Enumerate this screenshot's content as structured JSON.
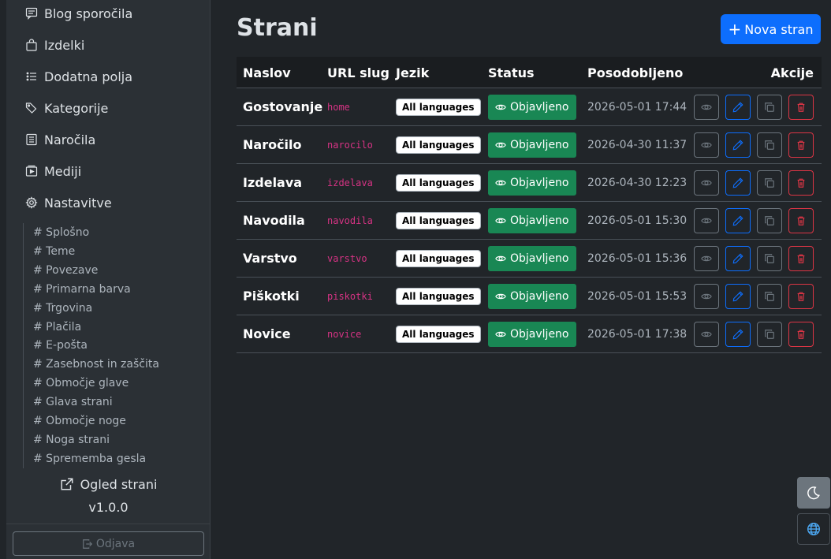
{
  "sidebar": {
    "items": [
      {
        "label": "Blog sporočila",
        "icon": "chat-square-icon"
      },
      {
        "label": "Izdelki",
        "icon": "bag-icon"
      },
      {
        "label": "Dodatna polja",
        "icon": "list-icon"
      },
      {
        "label": "Kategorije",
        "icon": "tags-icon"
      },
      {
        "label": "Naročila",
        "icon": "receipt-icon"
      },
      {
        "label": "Mediji",
        "icon": "media-icon"
      },
      {
        "label": "Nastavitve",
        "icon": "gear-icon"
      }
    ],
    "settings_items": [
      "# Splošno",
      "# Teme",
      "# Povezave",
      "# Primarna barva",
      "# Trgovina",
      "# Plačila",
      "# E-pošta",
      "# Zasebnost in zaščita",
      "# Območje glave",
      "# Glava strani",
      "# Območje noge",
      "# Noga strani",
      "# Sprememba gesla"
    ],
    "preview_label": "Ogled strani",
    "version": "v1.0.0",
    "logout_label": "Odjava"
  },
  "main": {
    "title": "Strani",
    "new_button_label": "Nova stran",
    "table": {
      "headers": {
        "title": "Naslov",
        "slug": "URL slug",
        "language": "Jezik",
        "status": "Status",
        "updated": "Posodobljeno",
        "actions": "Akcije"
      },
      "rows": [
        {
          "title": "Gostovanje",
          "slug": "home",
          "language": "All languages",
          "status": "Objavljeno",
          "updated": "2026-05-01 17:44"
        },
        {
          "title": "Naročilo",
          "slug": "narocilo",
          "language": "All languages",
          "status": "Objavljeno",
          "updated": "2026-04-30 11:37"
        },
        {
          "title": "Izdelava",
          "slug": "izdelava",
          "language": "All languages",
          "status": "Objavljeno",
          "updated": "2026-04-30 12:23"
        },
        {
          "title": "Navodila",
          "slug": "navodila",
          "language": "All languages",
          "status": "Objavljeno",
          "updated": "2026-05-01 15:30"
        },
        {
          "title": "Varstvo",
          "slug": "varstvo",
          "language": "All languages",
          "status": "Objavljeno",
          "updated": "2026-05-01 15:36"
        },
        {
          "title": "Piškotki",
          "slug": "piskotki",
          "language": "All languages",
          "status": "Objavljeno",
          "updated": "2026-05-01 15:53"
        },
        {
          "title": "Novice",
          "slug": "novice",
          "language": "All languages",
          "status": "Objavljeno",
          "updated": "2026-05-01 17:38"
        }
      ]
    }
  },
  "colors": {
    "primary": "#0d6efd",
    "success": "#198754",
    "danger": "#dc3545",
    "secondary": "#6c757d",
    "slug": "#d63384"
  }
}
